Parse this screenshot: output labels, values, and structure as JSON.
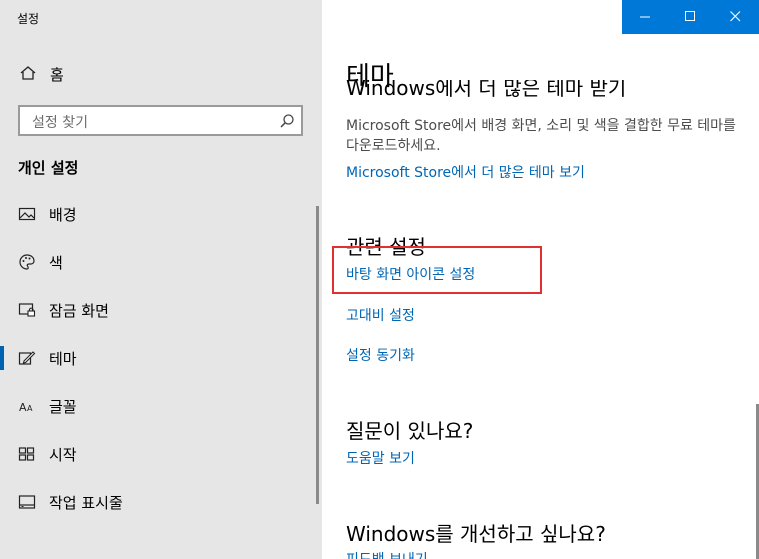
{
  "window": {
    "title": "설정"
  },
  "sidebar": {
    "home_label": "홈",
    "search_placeholder": "설정 찾기",
    "section_title": "개인 설정",
    "items": [
      {
        "label": "배경",
        "icon": "image-icon"
      },
      {
        "label": "색",
        "icon": "palette-icon"
      },
      {
        "label": "잠금 화면",
        "icon": "lock-screen-icon"
      },
      {
        "label": "테마",
        "icon": "theme-icon",
        "active": true
      },
      {
        "label": "글꼴",
        "icon": "font-icon"
      },
      {
        "label": "시작",
        "icon": "start-icon"
      },
      {
        "label": "작업 표시줄",
        "icon": "taskbar-icon"
      }
    ]
  },
  "main": {
    "page_title": "테마",
    "cut_heading": "Windows에서 더 많은 테마 받기",
    "store_description": "Microsoft Store에서 배경 화면, 소리 및 색을 결합한 무료 테마를 다운로드하세요.",
    "store_link": "Microsoft Store에서 더 많은 테마 보기",
    "related_heading": "관련 설정",
    "related_links": [
      "바탕 화면 아이콘 설정",
      "고대비 설정",
      "설정 동기화"
    ],
    "question_heading": "질문이 있나요?",
    "help_link": "도움말 보기",
    "improve_heading": "Windows를 개선하고 싶나요?",
    "feedback_link": "피드백 보내기"
  },
  "colors": {
    "accent": "#0078d7",
    "link": "#0066b4",
    "sidebar_bg": "#e6e6e6",
    "highlight_border": "#e03030"
  }
}
